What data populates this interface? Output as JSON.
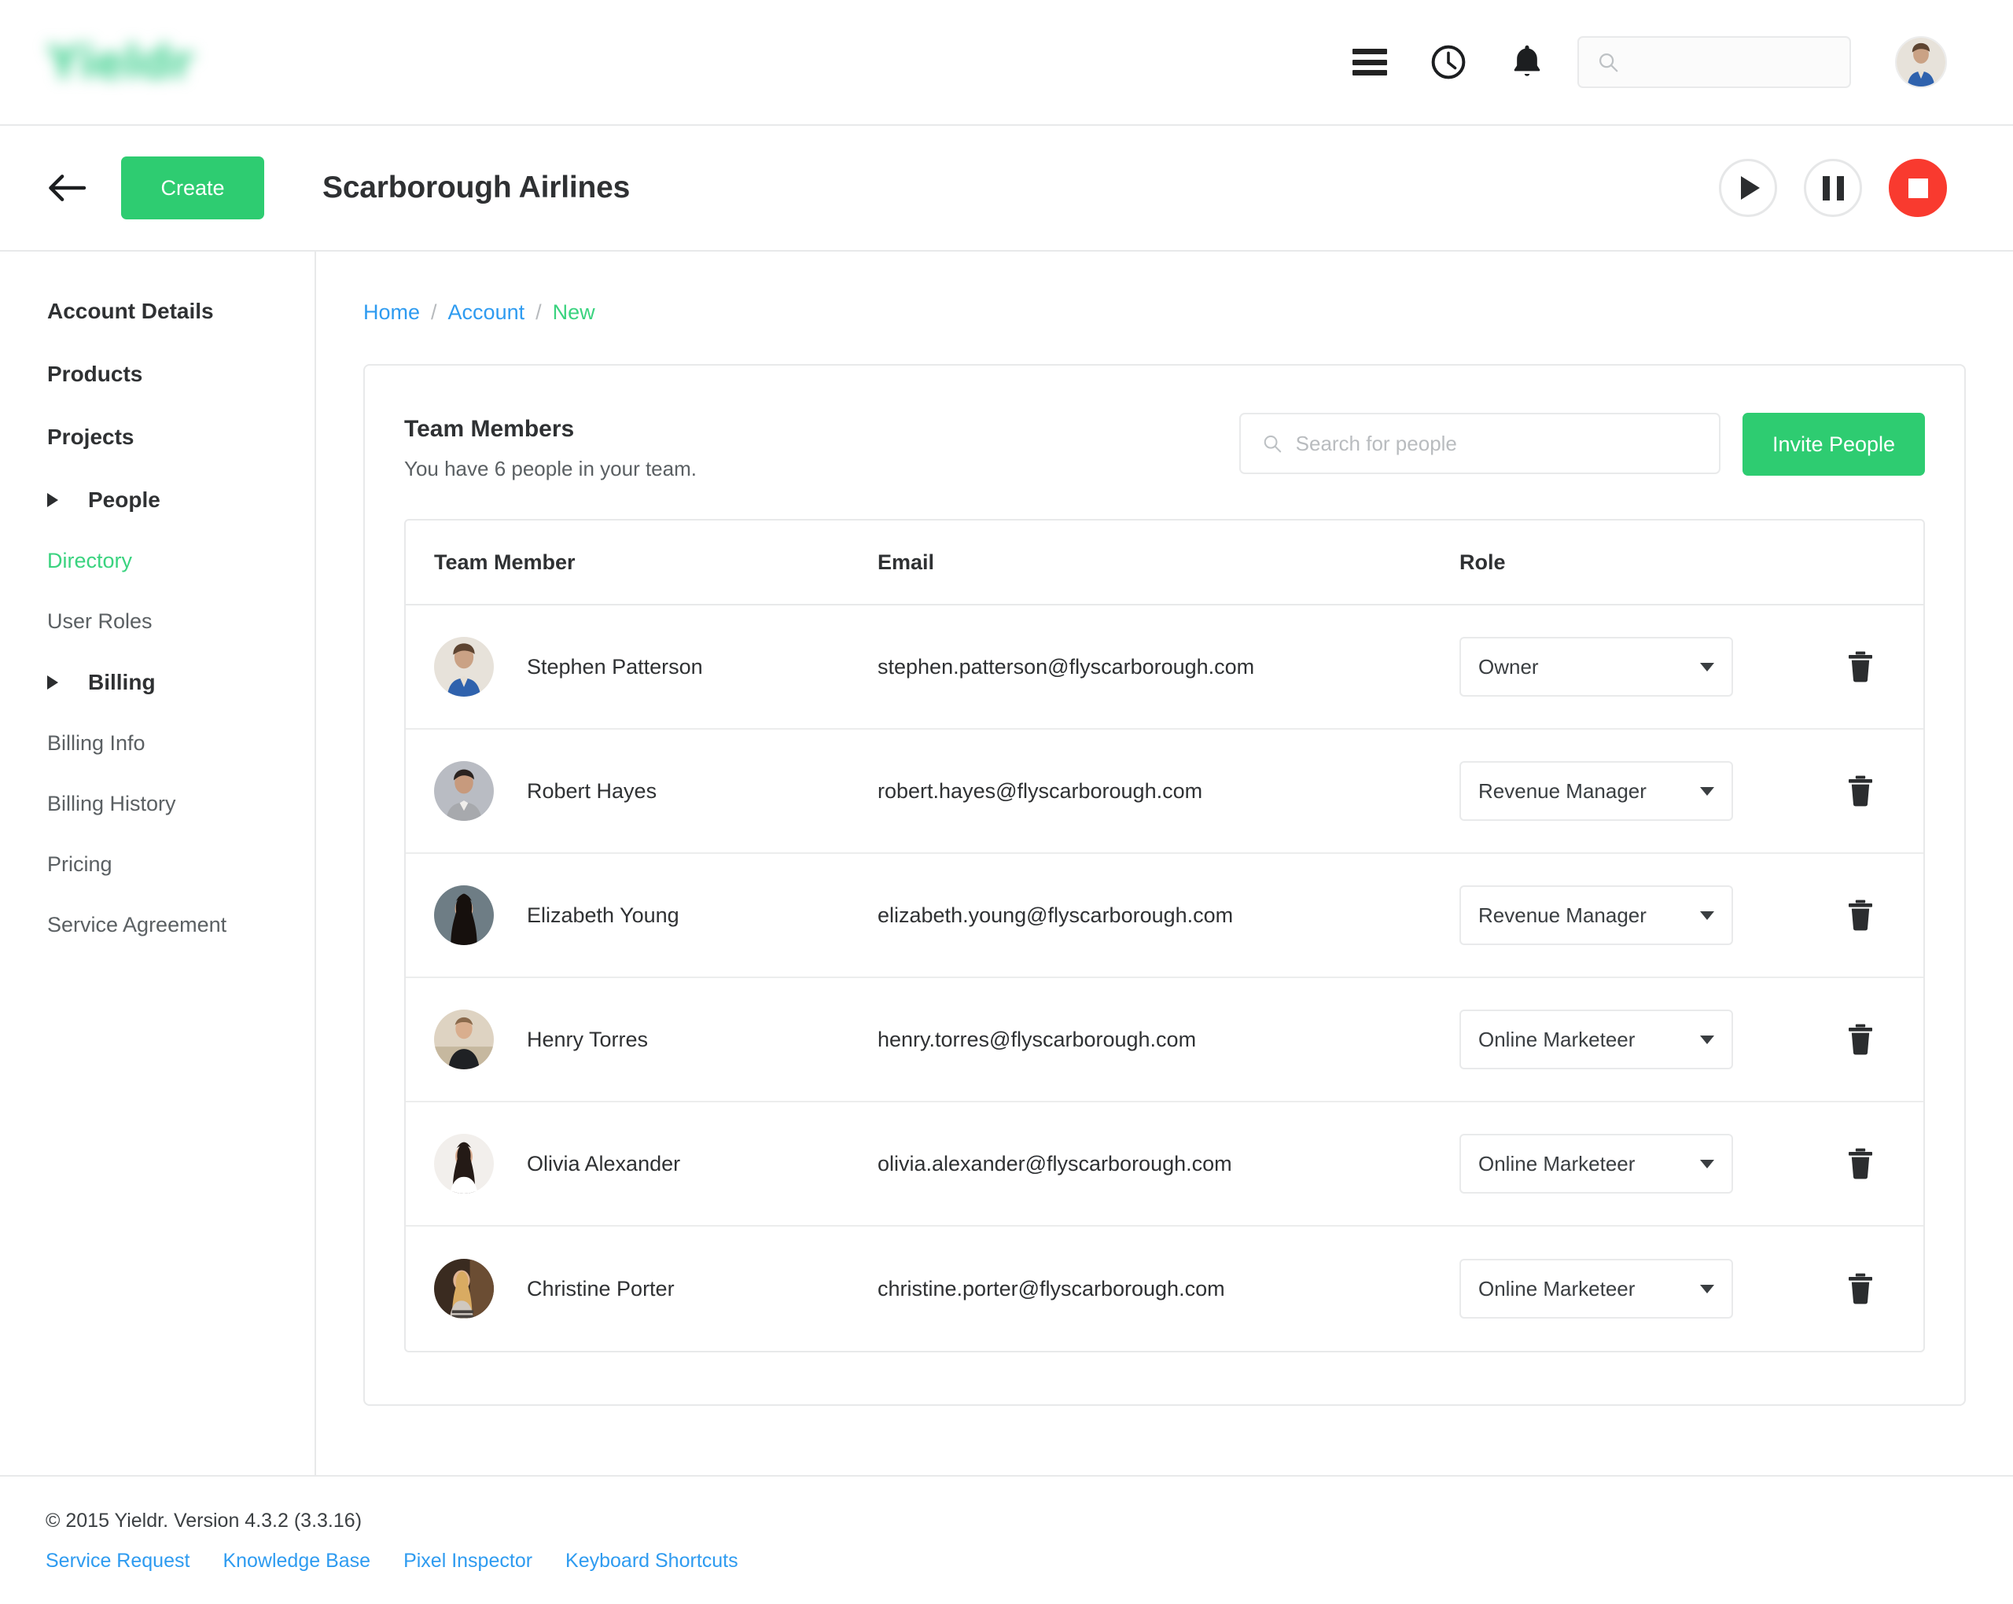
{
  "topbar": {
    "logo_text": "Yieldr",
    "icons": [
      "hamburger-icon",
      "clock-icon",
      "bell-icon"
    ],
    "search": {
      "value": "",
      "placeholder": ""
    },
    "avatar_label": "User avatar"
  },
  "subbar": {
    "back_label": "Back",
    "create_label": "Create",
    "title": "Scarborough Airlines",
    "transport": {
      "play": "Play",
      "pause": "Pause",
      "stop": "Stop"
    }
  },
  "sidebar": {
    "items": [
      {
        "label": "Account Details",
        "type": "top",
        "active": false
      },
      {
        "label": "Products",
        "type": "top",
        "active": false
      },
      {
        "label": "Projects",
        "type": "top",
        "active": false
      },
      {
        "label": "People",
        "type": "group",
        "active": false
      },
      {
        "label": "Directory",
        "type": "sub",
        "active": true
      },
      {
        "label": "User Roles",
        "type": "sub",
        "active": false
      },
      {
        "label": "Billing",
        "type": "group",
        "active": false
      },
      {
        "label": "Billing Info",
        "type": "sub",
        "active": false
      },
      {
        "label": "Billing History",
        "type": "sub",
        "active": false
      },
      {
        "label": "Pricing",
        "type": "sub",
        "active": false
      },
      {
        "label": "Service Agreement",
        "type": "sub",
        "active": false
      }
    ]
  },
  "breadcrumb": {
    "home": "Home",
    "account": "Account",
    "current": "New",
    "separator": "/"
  },
  "card": {
    "title": "Team Members",
    "subtitle": "You have 6 people in your team.",
    "search": {
      "value": "",
      "placeholder": "Search for people"
    },
    "invite_label": "Invite People",
    "columns": [
      "Team Member",
      "Email",
      "Role"
    ],
    "rows": [
      {
        "name": "Stephen Patterson",
        "email": "stephen.patterson@flyscarborough.com",
        "role": "Owner"
      },
      {
        "name": "Robert Hayes",
        "email": "robert.hayes@flyscarborough.com",
        "role": "Revenue Manager"
      },
      {
        "name": "Elizabeth Young",
        "email": "elizabeth.young@flyscarborough.com",
        "role": "Revenue Manager"
      },
      {
        "name": "Henry Torres",
        "email": "henry.torres@flyscarborough.com",
        "role": "Online Marketeer"
      },
      {
        "name": "Olivia Alexander",
        "email": "olivia.alexander@flyscarborough.com",
        "role": "Online Marketeer"
      },
      {
        "name": "Christine Porter",
        "email": "christine.porter@flyscarborough.com",
        "role": "Online Marketeer"
      }
    ],
    "delete_label": "Delete"
  },
  "footer": {
    "copyright": "© 2015 Yieldr. Version 4.3.2 (3.3.16)",
    "links": [
      "Service Request",
      "Knowledge Base",
      "Pixel Inspector",
      "Keyboard Shortcuts"
    ]
  },
  "colors": {
    "brand_green": "#2ecc71",
    "active_green": "#3ad37f",
    "link_blue": "#2e9bf0",
    "stop_red": "#f93a2f",
    "border": "#e8e9ea",
    "text": "#2f3133"
  }
}
